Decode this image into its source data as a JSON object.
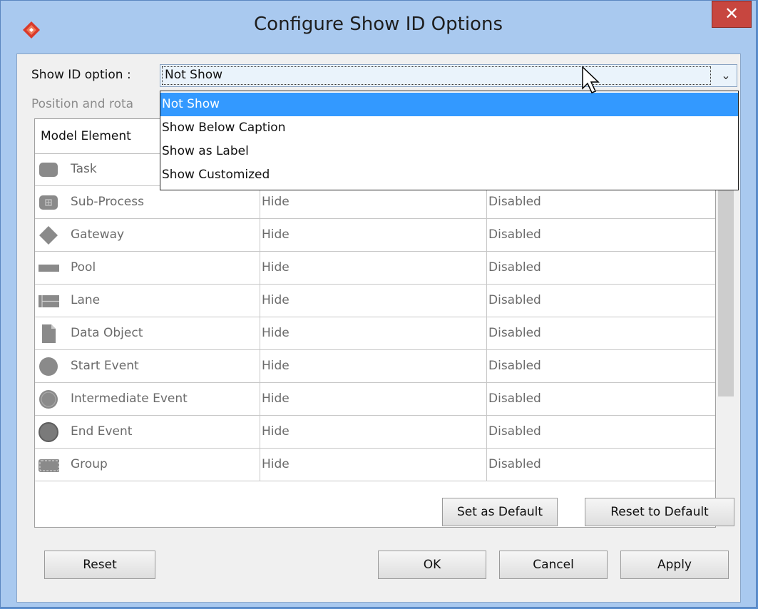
{
  "window": {
    "title": "Configure Show ID Options",
    "close_glyph": "✕"
  },
  "form": {
    "show_id_label": "Show ID option :",
    "show_id_value": "Not Show",
    "position_label": "Position and rota"
  },
  "dropdown": {
    "options": [
      "Not Show",
      "Show Below Caption",
      "Show as Label",
      "Show Customized"
    ],
    "selected_index": 0
  },
  "table": {
    "headers": [
      "Model Element"
    ],
    "rows": [
      {
        "element": "Task",
        "icon": "task-icon",
        "col2": "",
        "col3": ""
      },
      {
        "element": "Sub-Process",
        "icon": "sub-process-icon",
        "col2": "Hide",
        "col3": "Disabled"
      },
      {
        "element": "Gateway",
        "icon": "gateway-icon",
        "col2": "Hide",
        "col3": "Disabled"
      },
      {
        "element": "Pool",
        "icon": "pool-icon",
        "col2": "Hide",
        "col3": "Disabled"
      },
      {
        "element": "Lane",
        "icon": "lane-icon",
        "col2": "Hide",
        "col3": "Disabled"
      },
      {
        "element": "Data Object",
        "icon": "data-object-icon",
        "col2": "Hide",
        "col3": "Disabled"
      },
      {
        "element": "Start Event",
        "icon": "start-event-icon",
        "col2": "Hide",
        "col3": "Disabled"
      },
      {
        "element": "Intermediate Event",
        "icon": "intermediate-event-icon",
        "col2": "Hide",
        "col3": "Disabled"
      },
      {
        "element": "End Event",
        "icon": "end-event-icon",
        "col2": "Hide",
        "col3": "Disabled"
      },
      {
        "element": "Group",
        "icon": "group-icon",
        "col2": "Hide",
        "col3": "Disabled"
      }
    ]
  },
  "buttons": {
    "set_default": "Set as Default",
    "reset_default": "Reset to Default",
    "reset": "Reset",
    "ok": "OK",
    "cancel": "Cancel",
    "apply": "Apply"
  },
  "colors": {
    "selection": "#3399ff",
    "close_button": "#c7463f",
    "frame": "#a9c9ef"
  }
}
